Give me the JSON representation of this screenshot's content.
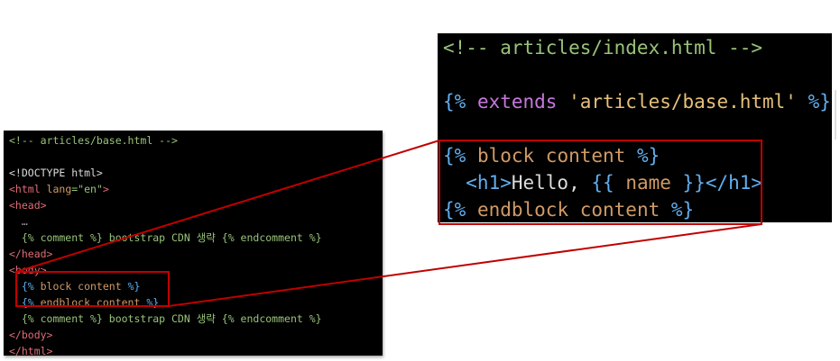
{
  "base_panel": {
    "lines": [
      [
        {
          "t": "<!-- articles/base.html -->",
          "c": "green"
        }
      ],
      [],
      [
        {
          "t": "<!DOCTYPE html>",
          "c": "white"
        }
      ],
      [
        {
          "t": "<html ",
          "c": "tag"
        },
        {
          "t": "lang",
          "c": "attr"
        },
        {
          "t": "=\"en\"",
          "c": "green"
        },
        {
          "t": ">",
          "c": "tag"
        }
      ],
      [
        {
          "t": "<head>",
          "c": "tag"
        }
      ],
      [
        {
          "t": "  …",
          "c": "gray"
        }
      ],
      [
        {
          "t": "  {% comment %} bootstrap CDN 생략 {% endcomment %}",
          "c": "green"
        }
      ],
      [
        {
          "t": "</head>",
          "c": "tag"
        }
      ],
      [
        {
          "t": "<body>",
          "c": "tag"
        }
      ],
      [
        {
          "t": "  {% ",
          "c": "blue"
        },
        {
          "t": "block content",
          "c": "orange"
        },
        {
          "t": " %}",
          "c": "blue"
        }
      ],
      [
        {
          "t": "  {% ",
          "c": "blue"
        },
        {
          "t": "endblock content",
          "c": "orange"
        },
        {
          "t": " %}",
          "c": "blue"
        }
      ],
      [
        {
          "t": "  {% comment %} bootstrap CDN 생략 {% endcomment %}",
          "c": "green"
        }
      ],
      [
        {
          "t": "</body>",
          "c": "tag"
        }
      ],
      [
        {
          "t": "</html>",
          "c": "tag"
        }
      ]
    ]
  },
  "index_panel": {
    "lines": [
      [
        {
          "t": "<!-- articles/index.html -->",
          "c": "green"
        }
      ],
      [],
      [
        {
          "t": "{% ",
          "c": "blue"
        },
        {
          "t": "extends ",
          "c": "pink"
        },
        {
          "t": "'articles/base.html'",
          "c": "lightorange"
        },
        {
          "t": " %}",
          "c": "blue"
        }
      ],
      [],
      [
        {
          "t": "{% ",
          "c": "blue"
        },
        {
          "t": "block content",
          "c": "orange"
        },
        {
          "t": " %}",
          "c": "blue"
        }
      ],
      [
        {
          "t": "  <h1>",
          "c": "blue"
        },
        {
          "t": "Hello, ",
          "c": "white"
        },
        {
          "t": "{{ ",
          "c": "blue"
        },
        {
          "t": "name",
          "c": "orange"
        },
        {
          "t": " }}",
          "c": "blue"
        },
        {
          "t": "</h1>",
          "c": "blue"
        }
      ],
      [
        {
          "t": "{% ",
          "c": "blue"
        },
        {
          "t": "endblock content",
          "c": "orange"
        },
        {
          "t": " %}",
          "c": "blue"
        }
      ]
    ]
  },
  "colors": {
    "highlight": "#c00000",
    "background": "#000000"
  }
}
